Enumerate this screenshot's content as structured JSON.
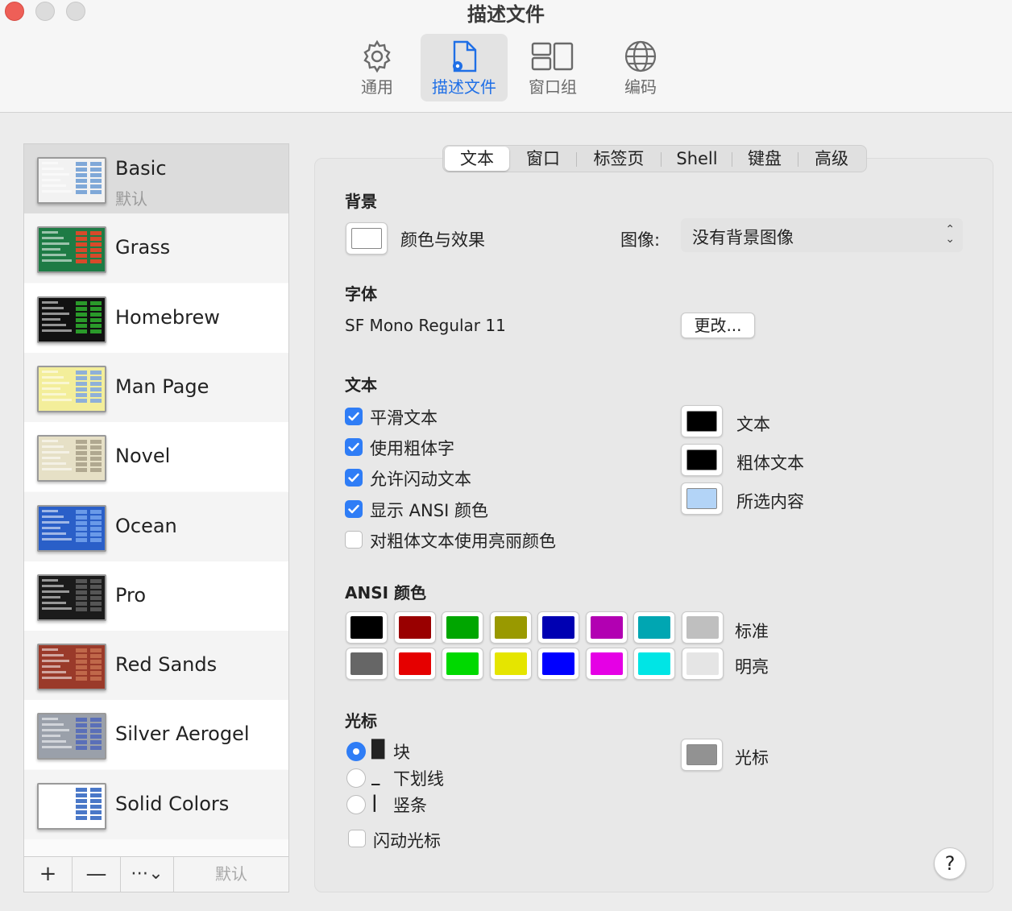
{
  "window": {
    "title": "描述文件"
  },
  "toolbar": {
    "items": [
      {
        "label": "通用",
        "icon": "gear-icon"
      },
      {
        "label": "描述文件",
        "icon": "profile-document-icon",
        "active": true
      },
      {
        "label": "窗口组",
        "icon": "window-group-icon"
      },
      {
        "label": "编码",
        "icon": "globe-icon"
      }
    ]
  },
  "sidebar": {
    "profiles": [
      {
        "name": "Basic",
        "subtitle": "默认",
        "selected": true,
        "thumb_bg": "#f2f2f2",
        "thumb_hl": "#7fa8d8"
      },
      {
        "name": "Grass",
        "thumb_bg": "#1e7b45",
        "thumb_hl": "#d84a2a"
      },
      {
        "name": "Homebrew",
        "thumb_bg": "#111111",
        "thumb_hl": "#2a9a2a"
      },
      {
        "name": "Man Page",
        "thumb_bg": "#f3ee9a",
        "thumb_hl": "#8fb0d8"
      },
      {
        "name": "Novel",
        "thumb_bg": "#e6e0c6",
        "thumb_hl": "#b0a890"
      },
      {
        "name": "Ocean",
        "thumb_bg": "#2a5fc8",
        "thumb_hl": "#6a9ae8"
      },
      {
        "name": "Pro",
        "thumb_bg": "#1b1b1b",
        "thumb_hl": "#555555"
      },
      {
        "name": "Red Sands",
        "thumb_bg": "#9a3a2a",
        "thumb_hl": "#c0684a"
      },
      {
        "name": "Silver Aerogel",
        "thumb_bg": "#9aa0aa",
        "thumb_hl": "#5a6fb8"
      },
      {
        "name": "Solid Colors",
        "thumb_bg": "#ffffff",
        "thumb_hl": "#4a78c8"
      }
    ],
    "footer": {
      "add": "+",
      "remove": "—",
      "more": "⋯⌄",
      "default_label": "默认"
    }
  },
  "tabs": [
    {
      "label": "文本",
      "active": true
    },
    {
      "label": "窗口"
    },
    {
      "label": "标签页"
    },
    {
      "label": "Shell"
    },
    {
      "label": "键盘"
    },
    {
      "label": "高级"
    }
  ],
  "background": {
    "section": "背景",
    "color_effects_label": "颜色与效果",
    "image_label": "图像:",
    "image_value": "没有背景图像"
  },
  "font": {
    "section": "字体",
    "value": "SF Mono Regular 11",
    "change_button": "更改..."
  },
  "text": {
    "section": "文本",
    "options": [
      {
        "label": "平滑文本",
        "checked": true
      },
      {
        "label": "使用粗体字",
        "checked": true
      },
      {
        "label": "允许闪动文本",
        "checked": true
      },
      {
        "label": "显示 ANSI 颜色",
        "checked": true
      },
      {
        "label": "对粗体文本使用亮丽颜色",
        "checked": false
      }
    ],
    "colors": [
      {
        "label": "文本",
        "color": "#000000"
      },
      {
        "label": "粗体文本",
        "color": "#000000"
      },
      {
        "label": "所选内容",
        "color": "#b3d4f7"
      }
    ]
  },
  "ansi": {
    "section": "ANSI 颜色",
    "standard_label": "标准",
    "bright_label": "明亮",
    "standard": [
      "#000000",
      "#990000",
      "#00a600",
      "#999900",
      "#0000b2",
      "#b200b2",
      "#00a6b2",
      "#bfbfbf"
    ],
    "bright": [
      "#666666",
      "#e50000",
      "#00d900",
      "#e5e500",
      "#0000ff",
      "#e500e5",
      "#00e5e5",
      "#e5e5e5"
    ]
  },
  "cursor": {
    "section": "光标",
    "options": [
      {
        "glyph": "█",
        "label": "块",
        "selected": true
      },
      {
        "glyph": "_",
        "label": "下划线",
        "selected": false
      },
      {
        "glyph": "|",
        "label": "竖条",
        "selected": false
      }
    ],
    "blink_label": "闪动光标",
    "blink_checked": false,
    "color_label": "光标",
    "color": "#929292"
  },
  "help": {
    "label": "?"
  }
}
